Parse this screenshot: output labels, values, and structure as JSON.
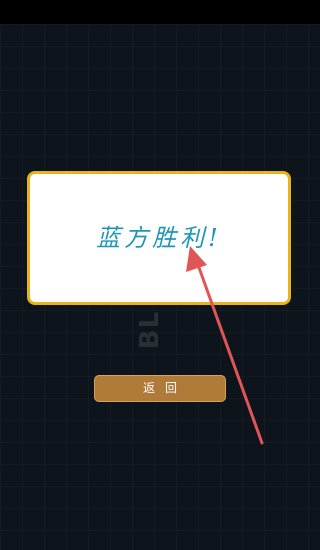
{
  "result_dialog": {
    "message": "蓝方胜利!"
  },
  "actions": {
    "back_label": "返回"
  },
  "background": {
    "watermark": "BL"
  },
  "colors": {
    "background": "#0e141b",
    "dialog_border": "#e8b41a",
    "dialog_text": "#1f96b8",
    "button": "#b07a38",
    "annotation_arrow": "#e05555"
  }
}
